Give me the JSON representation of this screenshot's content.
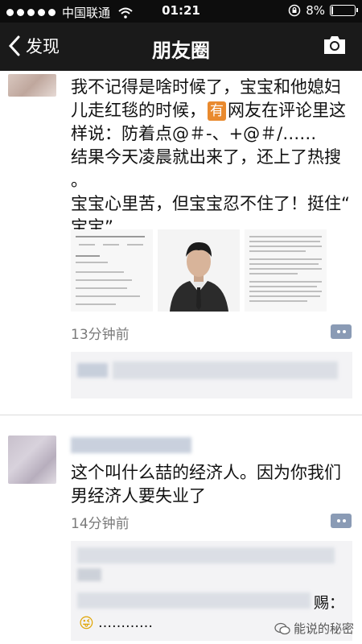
{
  "status_bar": {
    "carrier": "中国联通",
    "time": "01:21",
    "battery": "8%",
    "battery_level": 0.08
  },
  "nav": {
    "back_label": "发现",
    "title": "朋友圈"
  },
  "post1": {
    "line1": "我不记得是啥时候了，宝宝和他媳妇",
    "line2_before": "儿走红毯的时候，",
    "chip": "有",
    "line2_after": "网友在评论里这",
    "line3": "样说：防着点@＃-、+@＃/……",
    "line4": "结果今天凌晨就出来了，还上了热搜",
    "line5": "。",
    "line6": "宝宝心里苦，但宝宝忍不住了！挺住“",
    "line7": "宝宝”",
    "time": "13分钟前"
  },
  "post2": {
    "line1": "这个叫什么喆的经济人。因为你我们",
    "line2": "男经济人要失业了",
    "time": "14分钟前",
    "comment2_tail": "赐：",
    "comment2_emoji": "😜",
    "comment2_dots": "…………"
  },
  "watermark": {
    "text": "能说的秘密"
  },
  "colors": {
    "navbar": "#1a1a1a",
    "statusbar": "#0d0d0d",
    "link": "#576b95",
    "chip": "#e98a2e"
  }
}
